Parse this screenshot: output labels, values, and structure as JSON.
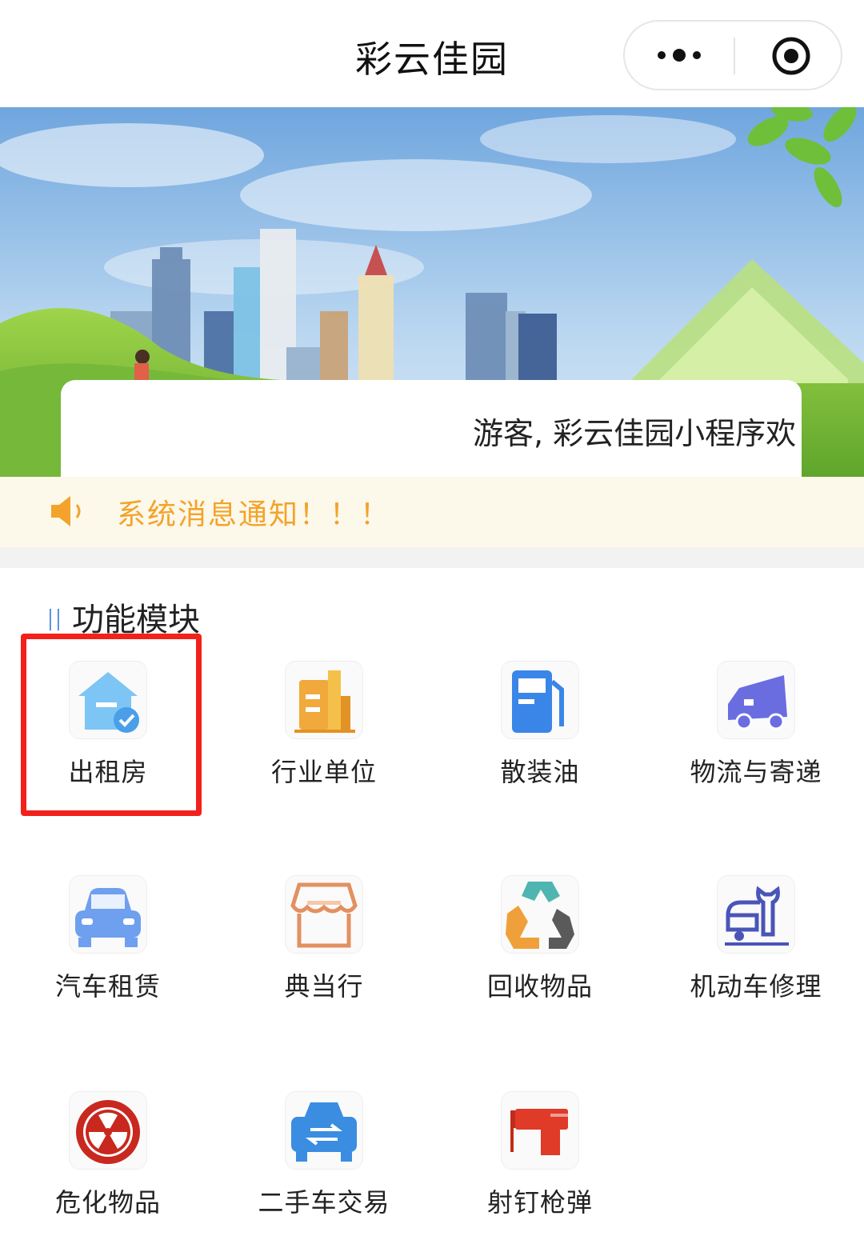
{
  "header": {
    "title": "彩云佳园",
    "more_icon": "more-dots-icon",
    "close_icon": "record-target-icon"
  },
  "banner": {
    "welcome_text": "游客, 彩云佳园小程序欢"
  },
  "notice": {
    "icon": "speaker-icon",
    "text": "系统消息通知！！！",
    "color": "#f3a32b"
  },
  "section": {
    "title": "功能模块",
    "marker": "ll"
  },
  "modules": [
    {
      "label": "出租房",
      "icon": "rental-house-icon",
      "selected": true
    },
    {
      "label": "行业单位",
      "icon": "building-icon"
    },
    {
      "label": "散装油",
      "icon": "gas-pump-icon"
    },
    {
      "label": "物流与寄递",
      "icon": "delivery-truck-icon"
    },
    {
      "label": "汽车租赁",
      "icon": "car-icon"
    },
    {
      "label": "典当行",
      "icon": "shop-awning-icon"
    },
    {
      "label": "回收物品",
      "icon": "recycle-icon"
    },
    {
      "label": "机动车修理",
      "icon": "car-repair-wrench-icon"
    },
    {
      "label": "危化物品",
      "icon": "radiation-hazard-icon"
    },
    {
      "label": "二手车交易",
      "icon": "used-car-exchange-icon"
    },
    {
      "label": "射钉枪弹",
      "icon": "nail-gun-icon"
    }
  ],
  "colors": {
    "highlight": "#f2211c",
    "accent_blue": "#3b7bd8"
  }
}
